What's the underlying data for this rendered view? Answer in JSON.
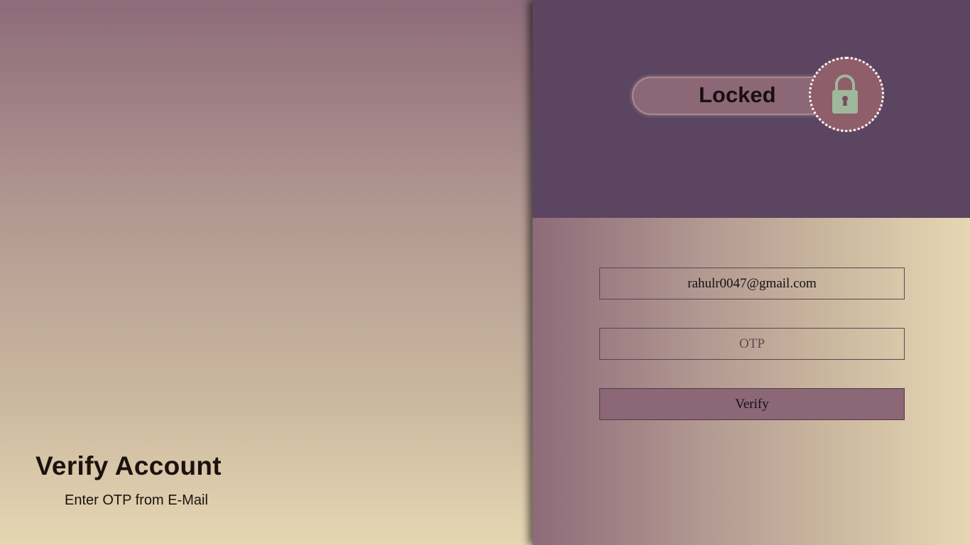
{
  "left": {
    "heading": "Verify Account",
    "subheading": "Enter OTP from E-Mail"
  },
  "lock": {
    "label": "Locked",
    "icon": "padlock-icon"
  },
  "form": {
    "email_value": "rahulr0047@gmail.com",
    "otp_placeholder": "OTP",
    "verify_label": "Verify"
  },
  "colors": {
    "top_box": "#5c4560",
    "lock_pill": "#8c6776",
    "lock_circle": "#8e5e6a",
    "lock_icon": "#9fb79b",
    "button": "#8c6776"
  }
}
